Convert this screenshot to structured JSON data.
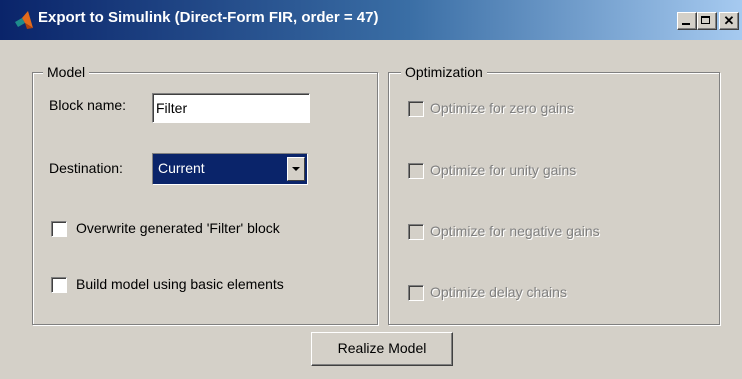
{
  "window": {
    "title": "Export to Simulink (Direct-Form FIR, order = 47)",
    "icon": "matlab-logo-icon",
    "controls": {
      "minimize": "minimize-icon",
      "maximize": "maximize-icon",
      "close": "✕"
    }
  },
  "model": {
    "legend": "Model",
    "block_name_label": "Block name:",
    "block_name_value": "Filter",
    "destination_label": "Destination:",
    "destination_value": "Current",
    "overwrite_label": "Overwrite generated 'Filter' block",
    "overwrite_checked": false,
    "basic_elements_label": "Build model using basic elements",
    "basic_elements_checked": false
  },
  "optimization": {
    "legend": "Optimization",
    "options": [
      {
        "label": "Optimize for zero gains",
        "enabled": false,
        "checked": false
      },
      {
        "label": "Optimize for unity gains",
        "enabled": false,
        "checked": false
      },
      {
        "label": "Optimize for negative gains",
        "enabled": false,
        "checked": false
      },
      {
        "label": "Optimize delay chains",
        "enabled": false,
        "checked": false
      }
    ]
  },
  "actions": {
    "realize_label": "Realize Model"
  },
  "colors": {
    "face": "#d4d0c8",
    "title_start": "#0a246a",
    "title_end": "#a6caf0",
    "selection": "#0a246a",
    "disabled_text": "#808080"
  }
}
